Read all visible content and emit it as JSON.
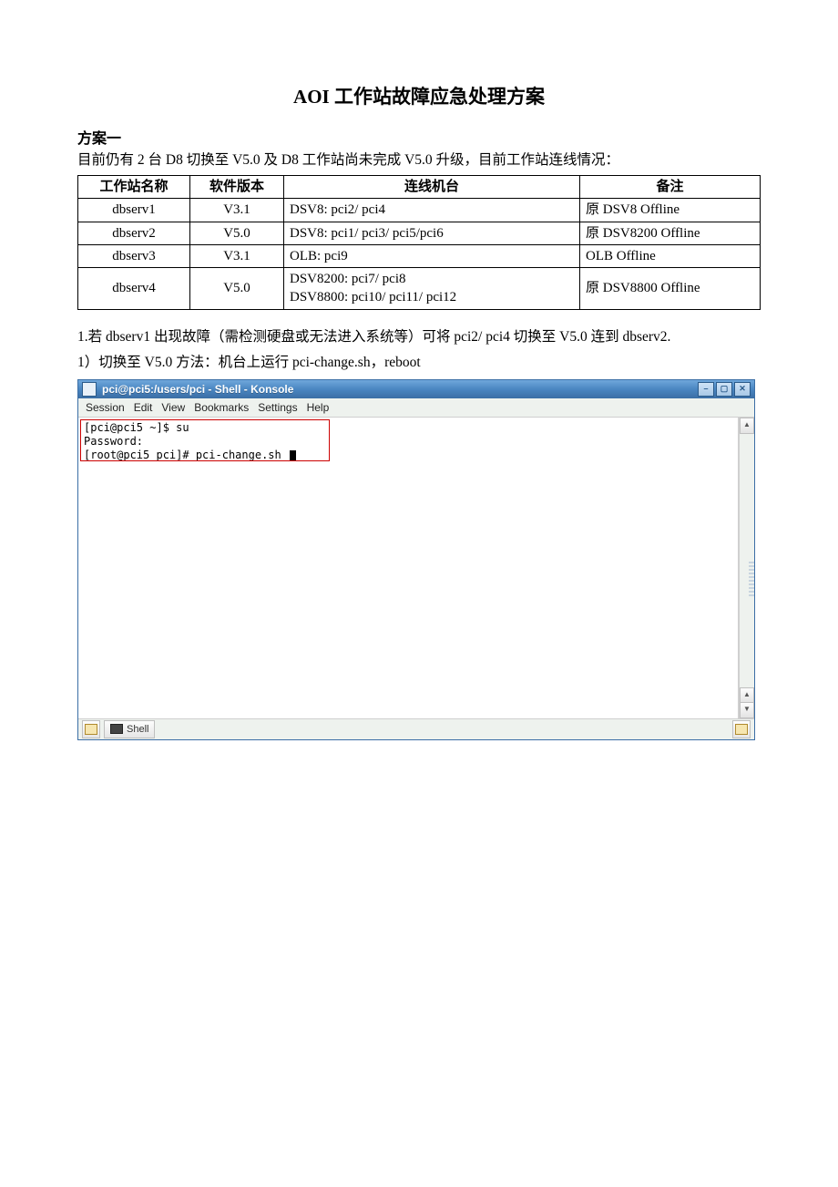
{
  "doc": {
    "title": "AOI 工作站故障应急处理方案",
    "plan_heading": "方案一",
    "intro": "目前仍有 2 台 D8 切换至 V5.0 及 D8 工作站尚未完成 V5.0 升级，目前工作站连线情况：",
    "table": {
      "headers": [
        "工作站名称",
        "软件版本",
        "连线机台",
        "备注"
      ],
      "rows": [
        {
          "name": "dbserv1",
          "ver": "V3.1",
          "machines": "DSV8: pci2/ pci4",
          "note": "原 DSV8 Offline"
        },
        {
          "name": "dbserv2",
          "ver": "V5.0",
          "machines": "DSV8: pci1/ pci3/ pci5/pci6",
          "note": "原 DSV8200 Offline"
        },
        {
          "name": "dbserv3",
          "ver": "V3.1",
          "machines": "OLB: pci9",
          "note": "OLB Offline"
        },
        {
          "name": "dbserv4",
          "ver": "V5.0",
          "machines": "DSV8200: pci7/ pci8\nDSV8800: pci10/ pci11/ pci12",
          "note": "原 DSV8800 Offline"
        }
      ]
    },
    "step1": "1.若 dbserv1 出现故障（需检测硬盘或无法进入系统等）可将 pci2/ pci4 切换至 V5.0 连到 dbserv2.",
    "step1_1": "1）切换至 V5.0 方法：机台上运行 pci-change.sh，reboot"
  },
  "konsole": {
    "title": "pci@pci5:/users/pci - Shell - Konsole",
    "menus": [
      "Session",
      "Edit",
      "View",
      "Bookmarks",
      "Settings",
      "Help"
    ],
    "lines": [
      "[pci@pci5 ~]$ su",
      "Password:",
      "[root@pci5 pci]# pci-change.sh "
    ],
    "tab_label": "Shell",
    "winbtns": {
      "min": "–",
      "max": "▢",
      "close": "✕"
    },
    "scroll": {
      "up": "▲",
      "down": "▼"
    }
  }
}
